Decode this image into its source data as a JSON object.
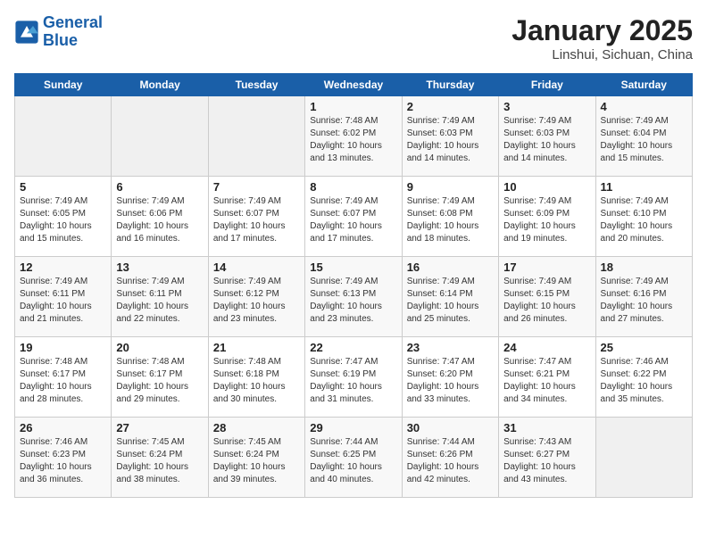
{
  "header": {
    "logo_line1": "General",
    "logo_line2": "Blue",
    "title": "January 2025",
    "subtitle": "Linshui, Sichuan, China"
  },
  "weekdays": [
    "Sunday",
    "Monday",
    "Tuesday",
    "Wednesday",
    "Thursday",
    "Friday",
    "Saturday"
  ],
  "weeks": [
    [
      {
        "day": "",
        "info": ""
      },
      {
        "day": "",
        "info": ""
      },
      {
        "day": "",
        "info": ""
      },
      {
        "day": "1",
        "info": "Sunrise: 7:48 AM\nSunset: 6:02 PM\nDaylight: 10 hours\nand 13 minutes."
      },
      {
        "day": "2",
        "info": "Sunrise: 7:49 AM\nSunset: 6:03 PM\nDaylight: 10 hours\nand 14 minutes."
      },
      {
        "day": "3",
        "info": "Sunrise: 7:49 AM\nSunset: 6:03 PM\nDaylight: 10 hours\nand 14 minutes."
      },
      {
        "day": "4",
        "info": "Sunrise: 7:49 AM\nSunset: 6:04 PM\nDaylight: 10 hours\nand 15 minutes."
      }
    ],
    [
      {
        "day": "5",
        "info": "Sunrise: 7:49 AM\nSunset: 6:05 PM\nDaylight: 10 hours\nand 15 minutes."
      },
      {
        "day": "6",
        "info": "Sunrise: 7:49 AM\nSunset: 6:06 PM\nDaylight: 10 hours\nand 16 minutes."
      },
      {
        "day": "7",
        "info": "Sunrise: 7:49 AM\nSunset: 6:07 PM\nDaylight: 10 hours\nand 17 minutes."
      },
      {
        "day": "8",
        "info": "Sunrise: 7:49 AM\nSunset: 6:07 PM\nDaylight: 10 hours\nand 17 minutes."
      },
      {
        "day": "9",
        "info": "Sunrise: 7:49 AM\nSunset: 6:08 PM\nDaylight: 10 hours\nand 18 minutes."
      },
      {
        "day": "10",
        "info": "Sunrise: 7:49 AM\nSunset: 6:09 PM\nDaylight: 10 hours\nand 19 minutes."
      },
      {
        "day": "11",
        "info": "Sunrise: 7:49 AM\nSunset: 6:10 PM\nDaylight: 10 hours\nand 20 minutes."
      }
    ],
    [
      {
        "day": "12",
        "info": "Sunrise: 7:49 AM\nSunset: 6:11 PM\nDaylight: 10 hours\nand 21 minutes."
      },
      {
        "day": "13",
        "info": "Sunrise: 7:49 AM\nSunset: 6:11 PM\nDaylight: 10 hours\nand 22 minutes."
      },
      {
        "day": "14",
        "info": "Sunrise: 7:49 AM\nSunset: 6:12 PM\nDaylight: 10 hours\nand 23 minutes."
      },
      {
        "day": "15",
        "info": "Sunrise: 7:49 AM\nSunset: 6:13 PM\nDaylight: 10 hours\nand 23 minutes."
      },
      {
        "day": "16",
        "info": "Sunrise: 7:49 AM\nSunset: 6:14 PM\nDaylight: 10 hours\nand 25 minutes."
      },
      {
        "day": "17",
        "info": "Sunrise: 7:49 AM\nSunset: 6:15 PM\nDaylight: 10 hours\nand 26 minutes."
      },
      {
        "day": "18",
        "info": "Sunrise: 7:49 AM\nSunset: 6:16 PM\nDaylight: 10 hours\nand 27 minutes."
      }
    ],
    [
      {
        "day": "19",
        "info": "Sunrise: 7:48 AM\nSunset: 6:17 PM\nDaylight: 10 hours\nand 28 minutes."
      },
      {
        "day": "20",
        "info": "Sunrise: 7:48 AM\nSunset: 6:17 PM\nDaylight: 10 hours\nand 29 minutes."
      },
      {
        "day": "21",
        "info": "Sunrise: 7:48 AM\nSunset: 6:18 PM\nDaylight: 10 hours\nand 30 minutes."
      },
      {
        "day": "22",
        "info": "Sunrise: 7:47 AM\nSunset: 6:19 PM\nDaylight: 10 hours\nand 31 minutes."
      },
      {
        "day": "23",
        "info": "Sunrise: 7:47 AM\nSunset: 6:20 PM\nDaylight: 10 hours\nand 33 minutes."
      },
      {
        "day": "24",
        "info": "Sunrise: 7:47 AM\nSunset: 6:21 PM\nDaylight: 10 hours\nand 34 minutes."
      },
      {
        "day": "25",
        "info": "Sunrise: 7:46 AM\nSunset: 6:22 PM\nDaylight: 10 hours\nand 35 minutes."
      }
    ],
    [
      {
        "day": "26",
        "info": "Sunrise: 7:46 AM\nSunset: 6:23 PM\nDaylight: 10 hours\nand 36 minutes."
      },
      {
        "day": "27",
        "info": "Sunrise: 7:45 AM\nSunset: 6:24 PM\nDaylight: 10 hours\nand 38 minutes."
      },
      {
        "day": "28",
        "info": "Sunrise: 7:45 AM\nSunset: 6:24 PM\nDaylight: 10 hours\nand 39 minutes."
      },
      {
        "day": "29",
        "info": "Sunrise: 7:44 AM\nSunset: 6:25 PM\nDaylight: 10 hours\nand 40 minutes."
      },
      {
        "day": "30",
        "info": "Sunrise: 7:44 AM\nSunset: 6:26 PM\nDaylight: 10 hours\nand 42 minutes."
      },
      {
        "day": "31",
        "info": "Sunrise: 7:43 AM\nSunset: 6:27 PM\nDaylight: 10 hours\nand 43 minutes."
      },
      {
        "day": "",
        "info": ""
      }
    ]
  ]
}
